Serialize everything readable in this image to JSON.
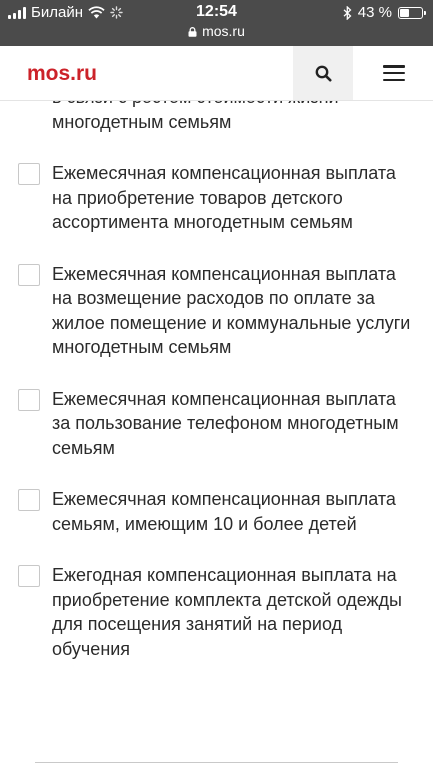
{
  "status_bar": {
    "carrier": "Билайн",
    "time": "12:54",
    "url": "mos.ru",
    "battery_text": "43 %",
    "battery_level": 0.43,
    "icons": [
      "signal-icon",
      "wifi-icon",
      "loading-icon",
      "lock-icon",
      "bluetooth-icon",
      "battery-icon"
    ]
  },
  "header": {
    "logo": "mos.ru",
    "brand_color": "#cc2229",
    "search_icon": "search-icon",
    "menu_icon": "hamburger-menu-icon"
  },
  "options": [
    {
      "label": "в связи с ростом стоимости жизни многодетным семьям",
      "checked": false
    },
    {
      "label": "Ежемесячная компенсационная выплата на приобретение товаров детского ассортимента многодетным семьям",
      "checked": false
    },
    {
      "label": "Ежемесячная компенсационная выплата на возмещение расходов по оплате за жилое помещение и коммунальные услуги многодетным семьям",
      "checked": false
    },
    {
      "label": "Ежемесячная компенсационная выплата за пользование телефоном многодетным семьям",
      "checked": false
    },
    {
      "label": "Ежемесячная компенсационная выплата семьям, имеющим 10 и более детей",
      "checked": false
    },
    {
      "label": "Ежегодная компенсационная выплата на приобретение комплекта детской одежды для посещения занятий на период обучения",
      "checked": false
    }
  ]
}
